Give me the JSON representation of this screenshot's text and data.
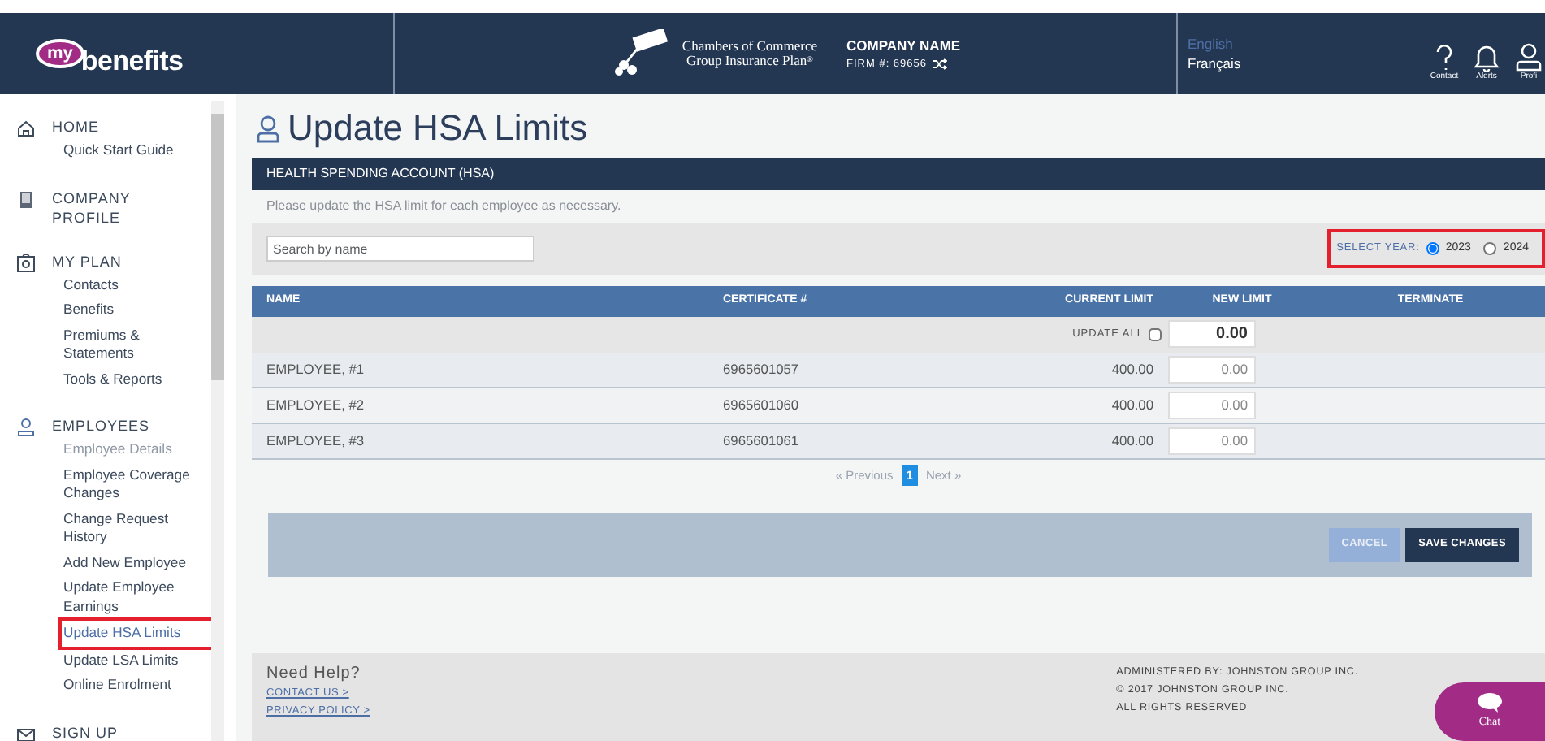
{
  "header": {
    "logo_prefix": "my",
    "logo_word": "benefits",
    "partner_line_1": "Chambers of Commerce",
    "partner_line_2": "Group Insurance Plan",
    "partner_mark": "®",
    "company_name": "COMPANY NAME",
    "firm": "FIRM #: 69656",
    "languages": [
      {
        "label": "English",
        "selected": true
      },
      {
        "label": "Français",
        "selected": false
      }
    ],
    "actions": [
      {
        "kind": "help",
        "label": "Contact"
      },
      {
        "kind": "bell",
        "label": "Alerts"
      },
      {
        "kind": "person",
        "label": "Profi"
      }
    ]
  },
  "sidebar": {
    "sections": [
      {
        "kind": "home",
        "label": "HOME",
        "items": [
          {
            "label": "Quick Start Guide",
            "selected": false,
            "disabled": false
          }
        ]
      },
      {
        "kind": "phone",
        "label": "COMPANY PROFILE"
      },
      {
        "kind": "plan",
        "label": "MY PLAN",
        "items": [
          {
            "label": "Contacts",
            "selected": false,
            "disabled": false
          },
          {
            "label": "Benefits",
            "selected": false,
            "disabled": false
          },
          {
            "label": "Premiums & Statements",
            "selected": false,
            "disabled": false
          },
          {
            "label": "Tools & Reports",
            "selected": false,
            "disabled": false
          }
        ]
      },
      {
        "kind": "person",
        "label": "EMPLOYEES",
        "items": [
          {
            "label": "Employee Details",
            "selected": false,
            "disabled": true
          },
          {
            "label": "Employee Coverage Changes",
            "selected": false,
            "disabled": false
          },
          {
            "label": "Change Request History",
            "selected": false,
            "disabled": false
          },
          {
            "label": "Add New Employee",
            "selected": false,
            "disabled": false
          },
          {
            "label": "Update Employee Earnings",
            "selected": false,
            "disabled": false
          },
          {
            "label": "Update HSA Limits",
            "selected": true,
            "disabled": false
          },
          {
            "label": "Update LSA Limits",
            "selected": false,
            "disabled": false
          },
          {
            "label": "Online Enrolment",
            "selected": false,
            "disabled": false
          }
        ]
      },
      {
        "kind": "mail",
        "label": "SIGN UP"
      }
    ]
  },
  "page_title": "Update HSA Limits",
  "panel": {
    "title": "HEALTH SPENDING ACCOUNT (HSA)",
    "note": "Please update the HSA limit for each employee as necessary.",
    "search": {
      "placeholder": "Search by name"
    },
    "year": {
      "label": "SELECT YEAR:",
      "highlighted": true,
      "options": [
        {
          "label": "2023",
          "selected": true
        },
        {
          "label": "2024",
          "selected": false
        }
      ]
    },
    "table": {
      "columns": [
        "NAME",
        "CERTIFICATE #",
        "CURRENT LIMIT",
        "NEW LIMIT",
        "TERMINATE"
      ],
      "update_all": {
        "label": "UPDATE ALL",
        "checked": false,
        "value": "0.00"
      },
      "rows": [
        {
          "name": "EMPLOYEE, #1",
          "certificate": "6965601057",
          "current_limit": "400.00",
          "new_limit": "0.00"
        },
        {
          "name": "EMPLOYEE, #2",
          "certificate": "6965601060",
          "current_limit": "400.00",
          "new_limit": "0.00"
        },
        {
          "name": "EMPLOYEE, #3",
          "certificate": "6965601061",
          "current_limit": "400.00",
          "new_limit": "0.00"
        }
      ]
    },
    "pagination": {
      "previous": "« Previous",
      "pages": [
        {
          "label": "1",
          "selected": true
        }
      ],
      "next": "Next »"
    },
    "buttons": [
      {
        "kind": "secondary",
        "label": "CANCEL"
      },
      {
        "kind": "primary",
        "label": "SAVE CHANGES"
      }
    ]
  },
  "footer": {
    "help_title": "Need Help?",
    "links": [
      "CONTACT US >",
      "PRIVACY POLICY >"
    ],
    "admin_lines": [
      "ADMINISTERED BY: JOHNSTON GROUP INC.",
      "© 2017 JOHNSTON GROUP INC.",
      "ALL RIGHTS RESERVED"
    ]
  },
  "chat": {
    "label": "Chat"
  }
}
